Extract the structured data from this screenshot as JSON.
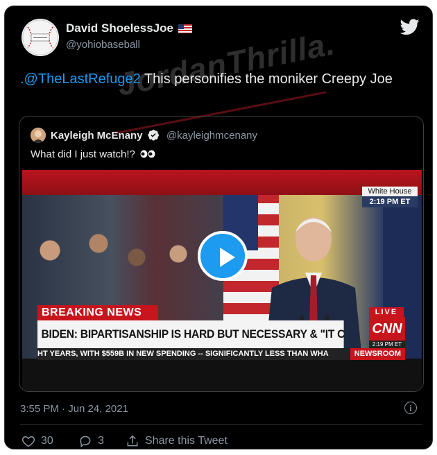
{
  "tweet": {
    "display_name": "David ShoelessJoe",
    "handle": "@yohiobaseball",
    "mention": ".@TheLastRefuge2",
    "text": " This personifies the moniker Creepy Joe",
    "timestamp": "3:55 PM · Jun 24, 2021"
  },
  "watermark": "JordanThrilla.",
  "quoted_tweet": {
    "display_name": "Kayleigh McEnany",
    "handle": "@kayleighmcenany",
    "text": "What did I just watch!?"
  },
  "video": {
    "location_label": "White House",
    "time_label": "2:19 PM ET",
    "breaking": "BREAKING NEWS",
    "headline": "BIDEN: BIPARTISANSHIP IS HARD BUT NECESSARY & \"IT CAN GET DONE\"",
    "live": "LIVE",
    "network": "CNN",
    "network_time": "2:19 PM ET",
    "ticker": "HT YEARS, WITH $559B IN NEW SPENDING -- SIGNIFICANTLY LESS THAN WHA",
    "program": "NEWSROOM"
  },
  "actions": {
    "likes": "30",
    "replies": "3",
    "share_label": "Share this Tweet"
  },
  "colors": {
    "background": "#000000",
    "link": "#1d9bf0",
    "muted": "#8b98a5",
    "cnn_red": "#c8141c"
  },
  "icons": [
    "baseball-avatar",
    "us-flag-icon",
    "twitter-bird-icon",
    "verified-icon",
    "eyes-emoji",
    "play-icon",
    "info-icon",
    "heart-icon",
    "reply-icon",
    "share-icon"
  ]
}
